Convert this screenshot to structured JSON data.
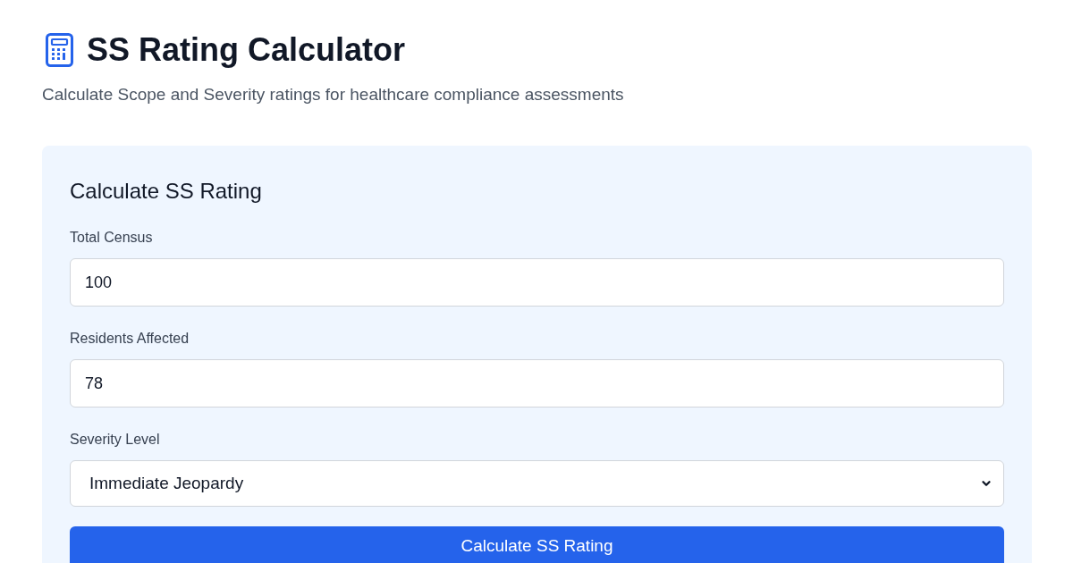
{
  "header": {
    "title": "SS Rating Calculator",
    "subtitle": "Calculate Scope and Severity ratings for healthcare compliance assessments"
  },
  "form": {
    "title": "Calculate SS Rating",
    "fields": [
      {
        "kind": "input",
        "label": "Total Census",
        "value": "100"
      },
      {
        "kind": "input",
        "label": "Residents Affected",
        "value": "78"
      },
      {
        "kind": "select",
        "label": "Severity Level",
        "value": "Immediate Jeopardy"
      }
    ],
    "submit": {
      "label": "Calculate SS Rating"
    }
  }
}
